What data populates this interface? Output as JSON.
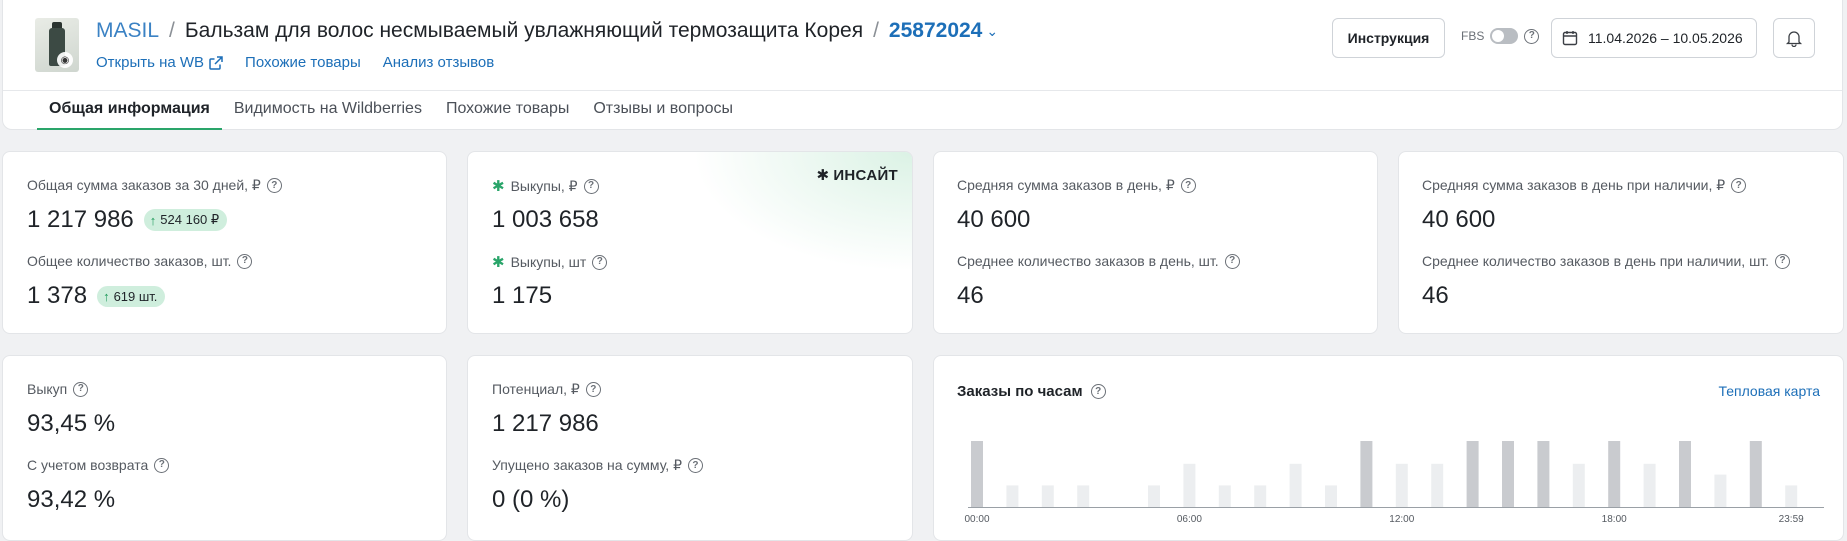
{
  "header": {
    "brand": "MASIL",
    "product_title": "Бальзам для волос несмываемый увлажняющий термозащита Корея",
    "article": "25872024",
    "links": {
      "open_wb": "Открыть на WB",
      "similar": "Похожие товары",
      "reviews_analysis": "Анализ отзывов"
    },
    "instruction_button": "Инструкция",
    "fbs_label": "FBS",
    "date_range": "11.04.2026 – 10.05.2026"
  },
  "tabs": [
    {
      "label": "Общая информация",
      "active": true
    },
    {
      "label": "Видимость на Wildberries",
      "active": false
    },
    {
      "label": "Похожие товары",
      "active": false
    },
    {
      "label": "Отзывы и вопросы",
      "active": false
    }
  ],
  "cards": {
    "c1": {
      "label1": "Общая сумма заказов за 30 дней, ₽",
      "value1": "1 217 986",
      "badge1": "524 160 ₽",
      "label2": "Общее количество заказов, шт.",
      "value2": "1 378",
      "badge2": "619 шт."
    },
    "c2": {
      "insight": "ИНСАЙТ",
      "label1": "Выкупы, ₽",
      "value1": "1 003 658",
      "label2": "Выкупы, шт",
      "value2": "1 175"
    },
    "c3": {
      "label1": "Средняя сумма заказов в день, ₽",
      "value1": "40 600",
      "label2": "Среднее количество заказов в день, шт.",
      "value2": "46"
    },
    "c4": {
      "label1": "Средняя сумма заказов в день при наличии, ₽",
      "value1": "40 600",
      "label2": "Среднее количество заказов в день при наличии, шт.",
      "value2": "46"
    },
    "c5": {
      "label1": "Выкуп",
      "value1": "93,45 %",
      "label2": "С учетом возврата",
      "value2": "93,42 %"
    },
    "c6": {
      "label1": "Потенциал, ₽",
      "value1": "1 217 986",
      "label2": "Упущено заказов на сумму, ₽",
      "value2": "0 (0 %)"
    }
  },
  "hourly": {
    "title": "Заказы по часам",
    "heatmap_link": "Тепловая карта"
  },
  "chart_data": {
    "type": "bar",
    "title": "Заказы по часам",
    "categories": [
      "00",
      "01",
      "02",
      "03",
      "04",
      "05",
      "06",
      "07",
      "08",
      "09",
      "10",
      "11",
      "12",
      "13",
      "14",
      "15",
      "16",
      "17",
      "18",
      "19",
      "20",
      "21",
      "22",
      "23"
    ],
    "x_tick_labels": [
      "00:00",
      "06:00",
      "12:00",
      "18:00",
      "23:59"
    ],
    "values": [
      55,
      18,
      18,
      18,
      0,
      18,
      36,
      18,
      18,
      36,
      18,
      55,
      36,
      36,
      55,
      55,
      55,
      36,
      55,
      36,
      55,
      27,
      55,
      18
    ],
    "highlight": [
      true,
      false,
      false,
      false,
      false,
      false,
      false,
      false,
      false,
      false,
      false,
      true,
      false,
      false,
      true,
      true,
      true,
      false,
      true,
      false,
      true,
      false,
      true,
      false
    ],
    "colors": {
      "high": "#c9cbcf",
      "low": "#eceef0"
    },
    "y_axis_labels": false,
    "grid": false
  }
}
